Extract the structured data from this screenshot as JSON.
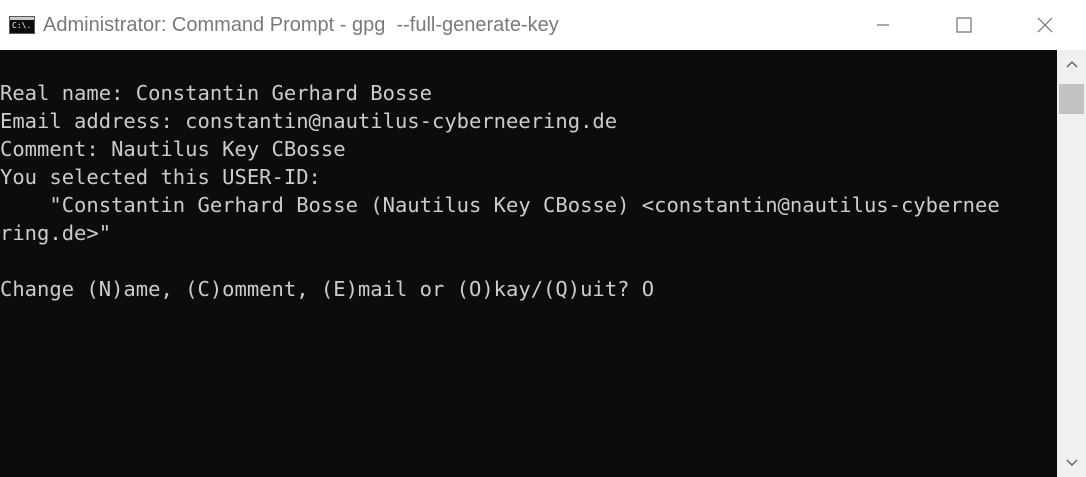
{
  "window": {
    "title": "Administrator: Command Prompt - gpg  --full-generate-key",
    "icon_label": "C:\\.",
    "controls": {
      "minimize": "minimize-icon",
      "maximize": "maximize-icon",
      "close": "close-icon"
    }
  },
  "console": {
    "lines": [
      "Real name: Constantin Gerhard Bosse",
      "Email address: constantin@nautilus-cyberneering.de",
      "Comment: Nautilus Key CBosse",
      "You selected this USER-ID:",
      "    \"Constantin Gerhard Bosse (Nautilus Key CBosse) <constantin@nautilus-cybernee",
      "ring.de>\"",
      "",
      "Change (N)ame, (C)omment, (E)mail or (O)kay/(Q)uit? O"
    ]
  },
  "colors": {
    "console_background": "#0c0c0c",
    "console_text": "#cccccc",
    "titlebar_text": "#7a7a7a",
    "scrollbar_track": "#f0f0f0",
    "scrollbar_thumb": "#c2c2c2"
  }
}
